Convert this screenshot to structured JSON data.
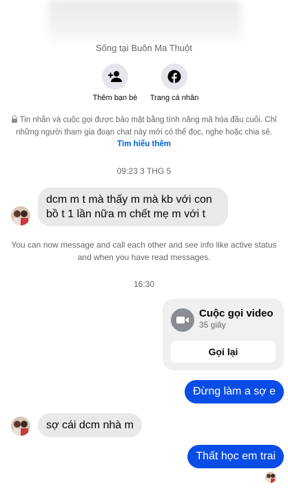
{
  "profile": {
    "location": "Sống tại Buôn Ma Thuột"
  },
  "actions": {
    "add_friend": {
      "label": "Thêm bạn bè",
      "icon": "add-friend-icon"
    },
    "profile": {
      "label": "Trang cá nhân",
      "icon": "facebook-icon"
    }
  },
  "e2ee": {
    "text": "Tin nhắn và cuộc gọi được bảo mật bằng tính năng mã hóa đầu cuối. Chỉ những người tham gia đoạn chat này mới có thể đọc, nghe hoặc chia sẻ. ",
    "link": "Tìm hiểu thêm"
  },
  "timestamps": {
    "first": "09:23 3 THG 5",
    "second": "16:30"
  },
  "messages": [
    {
      "from": "them",
      "text": "dcm m t mà thấy m mà kb với con bồ t 1 lần nữa m chết mẹ m với t"
    },
    {
      "from": "me",
      "text": "Đừng làm a sợ e"
    },
    {
      "from": "them",
      "text": "sợ cái dcm nhà m"
    },
    {
      "from": "me",
      "text": "Thất học em trai"
    }
  ],
  "notice": "You can now message and call each other and see info like active status and when you have read messages.",
  "call": {
    "title": "Cuộc gọi video",
    "duration": "35 giây",
    "button": "Gọi lại",
    "icon": "video-camera-icon"
  },
  "colors": {
    "outgoing_bubble": "#0a4de6",
    "incoming_bubble": "#e9e9eb",
    "link": "#0064d1"
  }
}
